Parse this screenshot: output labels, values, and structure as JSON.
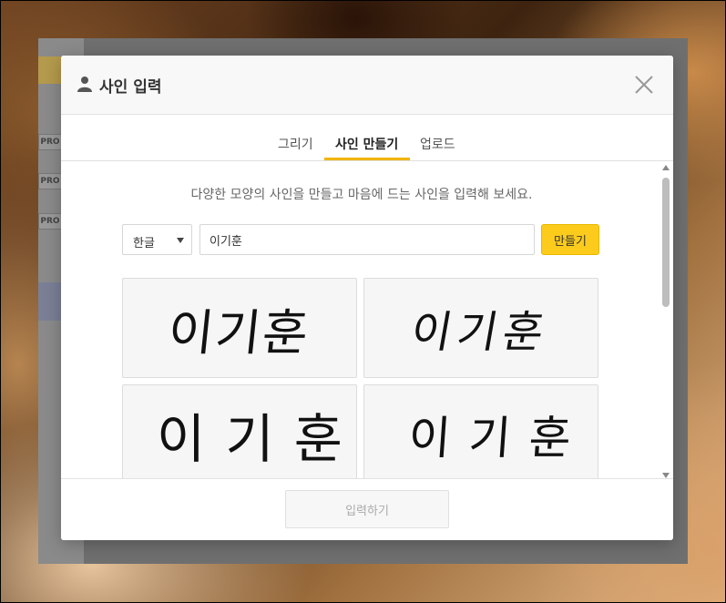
{
  "background": {
    "pro_badges": [
      "PRO",
      "PRO",
      "PRO"
    ]
  },
  "modal": {
    "title": "사인 입력",
    "tabs": [
      {
        "label": "그리기",
        "active": false
      },
      {
        "label": "사인 만들기",
        "active": true
      },
      {
        "label": "업로드",
        "active": false
      }
    ],
    "description": "다양한 모양의 사인을 만들고 마음에 드는 사인을 입력해 보세요.",
    "language_select": {
      "value": "한글"
    },
    "name_input": {
      "value": "이기훈"
    },
    "make_button_label": "만들기",
    "signatures": [
      {
        "text": "이기훈"
      },
      {
        "text": "이기훈"
      },
      {
        "text": "이기훈"
      },
      {
        "text": "이기훈"
      }
    ],
    "submit_button_label": "입력하기"
  },
  "colors": {
    "accent": "#fccb1c",
    "tab_underline": "#f2b400"
  }
}
